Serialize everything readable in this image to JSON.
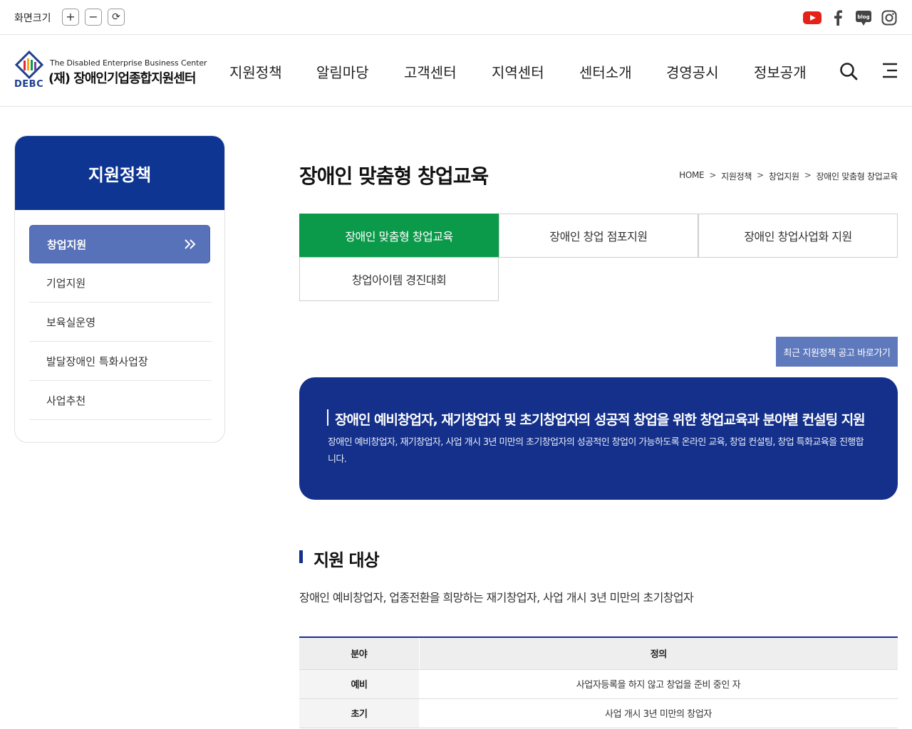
{
  "topbar": {
    "zoom_label": "화면크기",
    "zoom_in": "+",
    "zoom_out": "−",
    "zoom_reset": "⟳",
    "social": [
      "youtube-icon",
      "facebook-icon",
      "blog-icon",
      "instagram-icon"
    ],
    "blog_text": "blog"
  },
  "logo": {
    "en": "The Disabled Enterprise Business Center",
    "ko": "(재) 장애인기업종합지원센터",
    "abbr": "DEBC"
  },
  "gnb": [
    "지원정책",
    "알림마당",
    "고객센터",
    "지역센터",
    "센터소개",
    "경영공시",
    "정보공개"
  ],
  "sidebar": {
    "title": "지원정책",
    "active": "창업지원",
    "items": [
      "기업지원",
      "보육실운영",
      "발달장애인 특화사업장",
      "사업추천"
    ]
  },
  "page": {
    "title": "장애인 맞춤형 창업교육",
    "breadcrumb": [
      "HOME",
      "지원정책",
      "창업지원",
      "장애인 맞춤형 창업교육"
    ],
    "breadcrumb_sep": ">"
  },
  "tabs": [
    "장애인 맞춤형 창업교육",
    "장애인 창업 점포지원",
    "장애인 창업사업화 지원",
    "창업아이템 경진대회"
  ],
  "recent_button": "최근 지원정책 공고 바로가기",
  "hero": {
    "title": "장애인 예비창업자, 재기창업자 및 초기창업자의 성공적 창업을 위한 창업교육과 분야별 컨설팅 지원",
    "desc": "장애인 예비창업자, 재기창업자, 사업 개시 3년 미만의 초기창업자의 성공적인 창업이 가능하도록 온라인 교육, 창업 컨설팅, 창업 특화교육을 진행합니다."
  },
  "section": {
    "title": "지원 대상",
    "text": "장애인 예비창업자, 업종전환을 희망하는 재기창업자, 사업 개시 3년 미만의 초기창업자"
  },
  "table": {
    "headers": [
      "분야",
      "정의"
    ],
    "rows": [
      [
        "예비",
        "사업자등록을 하지 않고 창업을 준비 중인 자"
      ],
      [
        "초기",
        "사업 개시 3년 미만의 창업자"
      ]
    ]
  },
  "colors": {
    "brand_navy": "#14308a",
    "sidebar_head": "#0d3591",
    "active_tab": "#0a9a4a",
    "sidebar_active": "#5872b9",
    "recent_button": "#5f79bd"
  }
}
